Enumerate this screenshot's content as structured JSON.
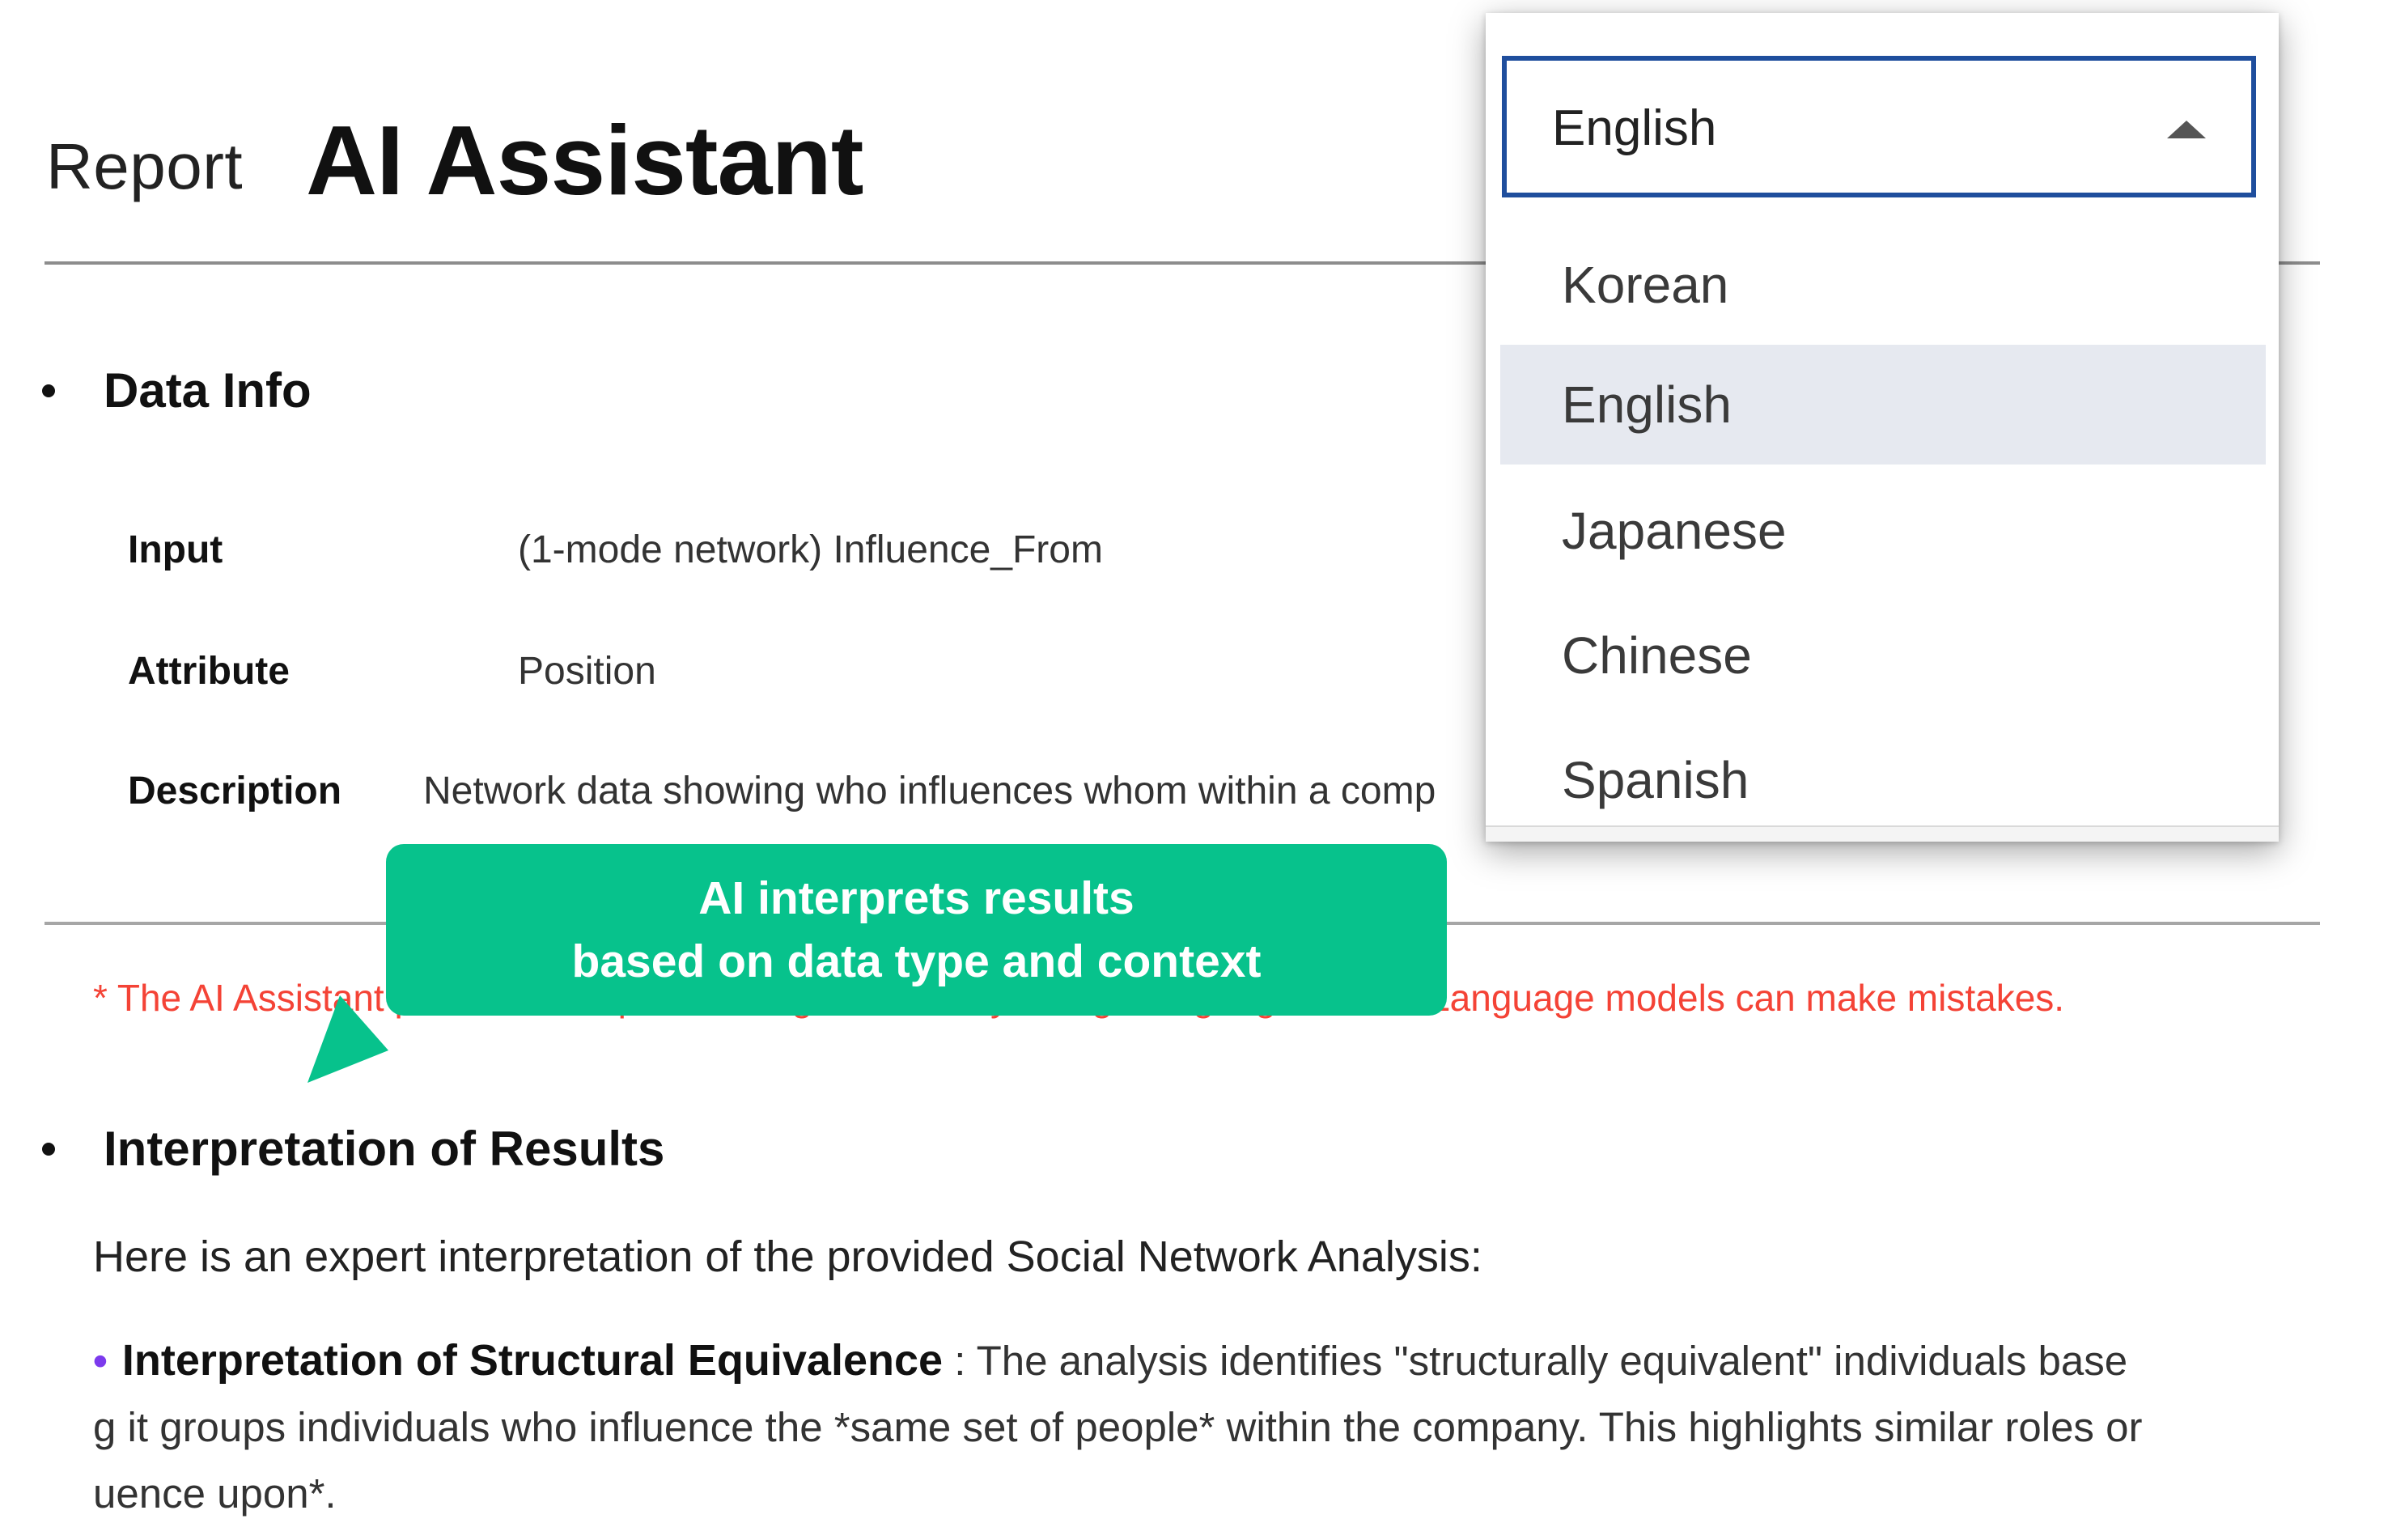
{
  "header": {
    "report_word": "Report",
    "title": "AI Assistant"
  },
  "data_info": {
    "heading": "Data Info",
    "rows": [
      {
        "label": "Input",
        "value": "(1-mode network) Influence_From"
      },
      {
        "label": "Attribute",
        "value": "Position"
      },
      {
        "label": "Description",
        "value": "Network data showing who influences whom within a comp"
      }
    ]
  },
  "disclaimer": "* The AI Assistant provides interpretations generated by a large language model. Language models can make mistakes.",
  "callout": {
    "line1": "AI interprets results",
    "line2": "based on data type and context",
    "color": "#07c28c"
  },
  "interpretation": {
    "heading": "Interpretation of Results",
    "intro": "Here is an expert interpretation of the provided Social Network Analysis:",
    "bullet_heading": "Interpretation of Structural Equivalence",
    "bullet_text_line1": " : The analysis identifies \"structurally equivalent\" individuals base",
    "bullet_text_line2": "g it groups individuals who influence the *same set of people* within the company. This highlights similar roles or",
    "bullet_text_line3": "uence upon*."
  },
  "language_select": {
    "selected": "English",
    "options": [
      "Korean",
      "English",
      "Japanese",
      "Chinese",
      "Spanish"
    ],
    "border_color": "#1f4e9d",
    "highlight_color": "#e6e9f0"
  },
  "colors": {
    "disclaimer": "#f44336",
    "bullet_accent": "#7c3aed"
  }
}
